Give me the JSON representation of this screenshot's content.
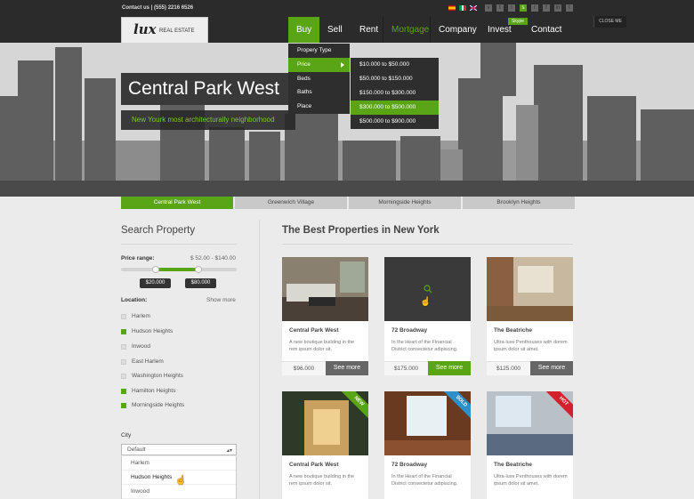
{
  "topbar": {
    "contact": "Contact us | (555) 2216 6526",
    "close_me": "CLOSE ME",
    "skype_tooltip": "Skype"
  },
  "logo": {
    "mark": "lux",
    "text": "REAL ESTATE"
  },
  "nav": {
    "items": [
      "Buy",
      "Sell",
      "Rent",
      "Mortgage",
      "Company",
      "Invest",
      "Contact"
    ]
  },
  "dropdown": {
    "items": [
      "Propery Type",
      "Price",
      "Beds",
      "Baths",
      "Place"
    ]
  },
  "subdropdown": {
    "items": [
      "$10.000 to $50.000",
      "$50.000 to $150.000",
      "$150.000 to $300.000",
      "$300.000 to $500.000",
      "$500.000 to $900.000"
    ]
  },
  "hero": {
    "title": "Central Park West",
    "subtitle": "New Yourk most architecturally neighborhood"
  },
  "tabs": [
    "Central Park West",
    "Greenwich Village",
    "Morningside Heights",
    "Brooklyn Heights"
  ],
  "search": {
    "heading": "Search Property",
    "price_label": "Price range:",
    "price_range": "$ 52.00 - $140.00",
    "min_value": "$20.000",
    "max_value": "$80.000",
    "range_fraction": [
      0.3,
      0.67
    ],
    "location_label": "Location:",
    "show_more": "Show more",
    "locations": [
      {
        "label": "Harlem",
        "checked": false
      },
      {
        "label": "Hudson Heights",
        "checked": true
      },
      {
        "label": "Inwood",
        "checked": false
      },
      {
        "label": "East Harlem",
        "checked": false
      },
      {
        "label": "Washington Heights",
        "checked": false
      },
      {
        "label": "Hamilton Heights",
        "checked": true
      },
      {
        "label": "Morningside Heights",
        "checked": true
      }
    ],
    "city_label": "City",
    "city_selected": "Default",
    "city_options": [
      "Harlem",
      "Hudson Heights",
      "Inwood"
    ]
  },
  "properties": {
    "heading": "The Best Properties in New York",
    "cards": [
      {
        "title": "Central Park West",
        "desc": "A new boutique building in the rem ipsum dolor sit.",
        "price": "$96.000",
        "button": "See more",
        "ribbon": ""
      },
      {
        "title": "72 Broadway",
        "desc": "In the Heart of the Financial District consectetur adipiscing.",
        "price": "$175.000",
        "button": "See more",
        "ribbon": ""
      },
      {
        "title": "The Beatriche",
        "desc": "Ultra-luxe Penthouses with dorem ipsum dolor sit amet.",
        "price": "$125.000",
        "button": "See more",
        "ribbon": ""
      },
      {
        "title": "Central Park West",
        "desc": "A new boutique building in the rem ipsum dolor sit.",
        "price": "",
        "button": "",
        "ribbon": "NEW"
      },
      {
        "title": "72 Broadway",
        "desc": "In the Heart of the Financial District consectetur adipiscing.",
        "price": "",
        "button": "",
        "ribbon": "SOLD"
      },
      {
        "title": "The Beatriche",
        "desc": "Ultra-luxe Penthouses with dorem ipsum dolor sit amet.",
        "price": "",
        "button": "",
        "ribbon": "HOT"
      }
    ]
  },
  "colors": {
    "accent": "#5aa516",
    "dark": "#2b2b2b",
    "ribbon_new": "#5aa516",
    "ribbon_sold": "#2f8fc9",
    "ribbon_hot": "#d4202c"
  }
}
